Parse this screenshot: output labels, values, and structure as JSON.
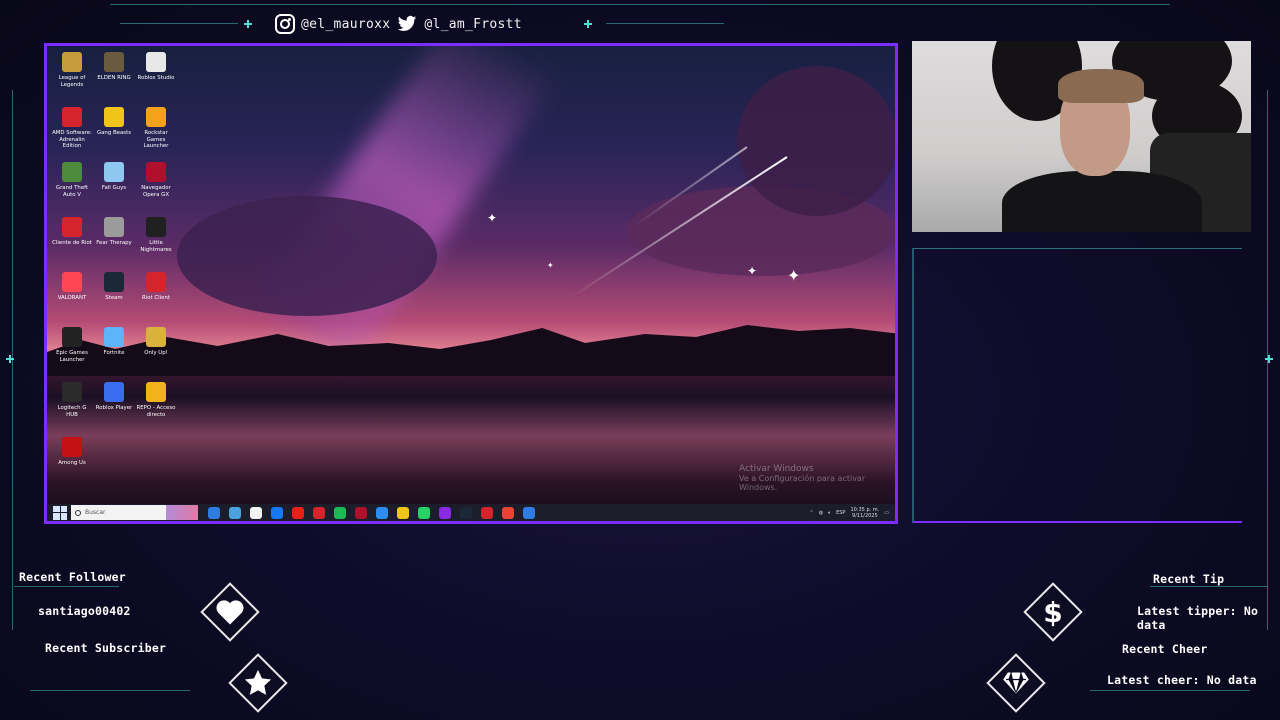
{
  "socials": {
    "instagram": "@el_mauroxx",
    "twitter": "@l_am_Frostt",
    "icons": [
      "instagram-icon",
      "twitter-icon"
    ]
  },
  "desktop": {
    "icons": [
      {
        "label": "League of Legends",
        "color": "#c89b3c"
      },
      {
        "label": "ELDEN RING",
        "color": "#6b5b3e"
      },
      {
        "label": "Roblox Studio",
        "color": "#e8e8e8"
      },
      {
        "label": "AMD Software: Adrenalin Edition",
        "color": "#d6242c"
      },
      {
        "label": "Gang Beasts",
        "color": "#f0c419"
      },
      {
        "label": "Rockstar Games Launcher",
        "color": "#f6a21b"
      },
      {
        "label": "Grand Theft Auto V",
        "color": "#4c8a3c"
      },
      {
        "label": "Fall Guys",
        "color": "#8ec8f0"
      },
      {
        "label": "Navegador Opera GX",
        "color": "#b1102c"
      },
      {
        "label": "Cliente de Riot",
        "color": "#d6242c"
      },
      {
        "label": "Fear Therapy",
        "color": "#9b9b9b"
      },
      {
        "label": "Little Nightmares",
        "color": "#202020"
      },
      {
        "label": "VALORANT",
        "color": "#ff4655"
      },
      {
        "label": "Steam",
        "color": "#1b2838"
      },
      {
        "label": "Riot Client",
        "color": "#d6242c"
      },
      {
        "label": "Epic Games Launcher",
        "color": "#222222"
      },
      {
        "label": "Fortnite",
        "color": "#5fb3f9"
      },
      {
        "label": "Only Up!",
        "color": "#d8b23a"
      },
      {
        "label": "Logitech G HUB",
        "color": "#2b2b2b"
      },
      {
        "label": "Roblox Player",
        "color": "#3a6cf0"
      },
      {
        "label": "REPO - Acceso directo",
        "color": "#f2b21b"
      },
      {
        "label": "Among Us",
        "color": "#c51111"
      }
    ],
    "watermark_title": "Activar Windows",
    "watermark_sub": "Ve a Configuración para activar Windows.",
    "taskbar": {
      "search_placeholder": "Buscar",
      "app_colors": [
        "#2f7de1",
        "#4aa3df",
        "#f2f2f2",
        "#1877f2",
        "#e62117",
        "#d6242c",
        "#1db954",
        "#b1102c",
        "#2d8cf0",
        "#f0c419",
        "#25d366",
        "#8a2be2",
        "#1b2838",
        "#d6242c",
        "#ea4335",
        "#2f7de1"
      ],
      "language": "ESP",
      "time": "10:35 p. m.",
      "date": "9/11/2025"
    }
  },
  "alerts": {
    "recent_follower_label": "Recent Follower",
    "recent_follower_value": "santiago00402",
    "recent_subscriber_label": "Recent Subscriber",
    "recent_tip_label": "Recent Tip",
    "recent_tip_value": "Latest tipper: No data",
    "recent_cheer_label": "Recent Cheer",
    "recent_cheer_value": "Latest cheer: No data",
    "icons": [
      "heart-icon",
      "star-icon",
      "dollar-icon",
      "gem-icon"
    ]
  },
  "colors": {
    "accent_purple": "#7b2cff",
    "accent_teal": "#3fb6b8",
    "background": "#0f0c2a"
  }
}
